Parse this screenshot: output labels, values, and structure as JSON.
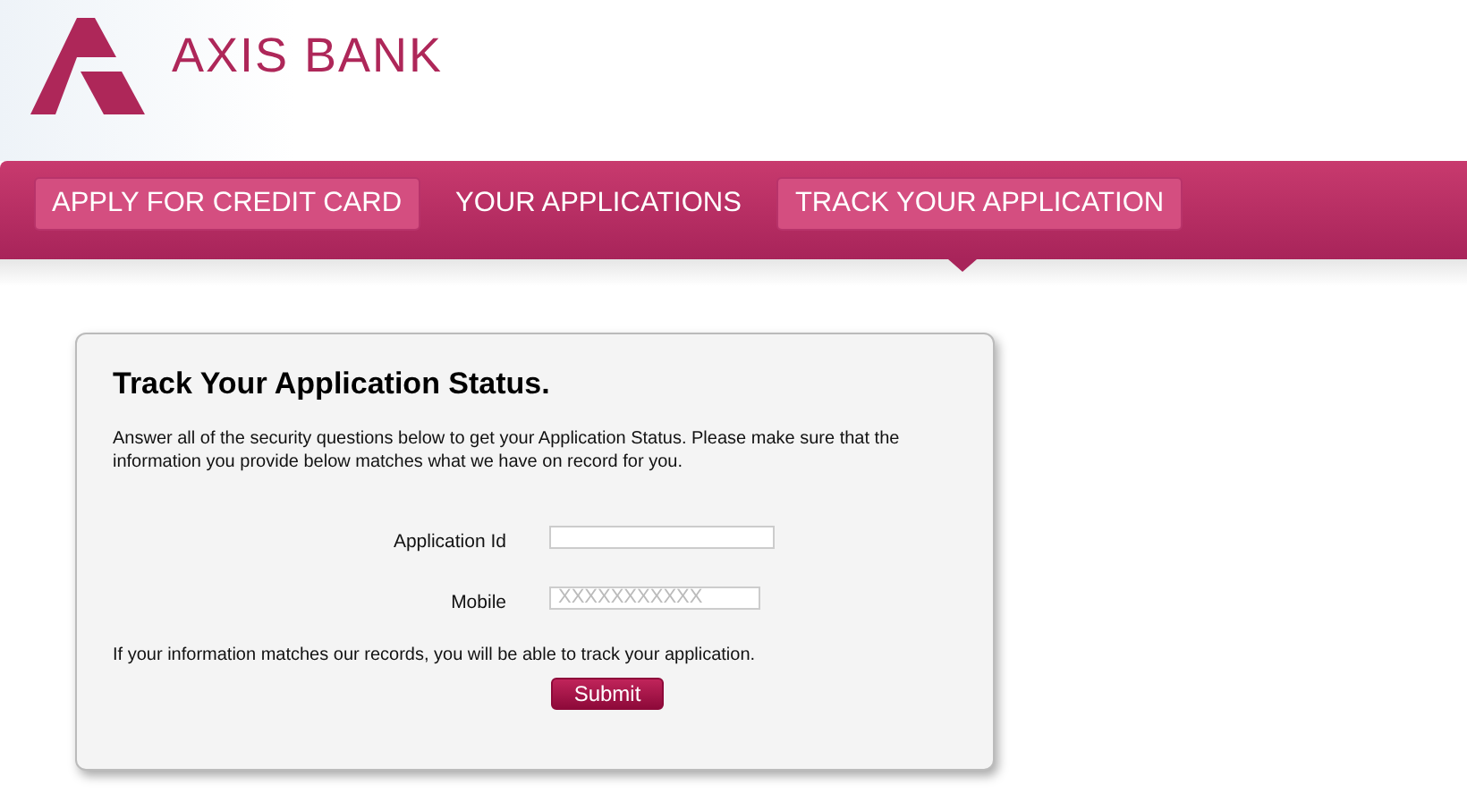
{
  "brand": {
    "name": "AXIS BANK"
  },
  "nav": [
    {
      "label": "APPLY FOR CREDIT CARD",
      "boxed": true,
      "selected": false
    },
    {
      "label": "YOUR APPLICATIONS",
      "boxed": false,
      "selected": false
    },
    {
      "label": "TRACK YOUR APPLICATION",
      "boxed": true,
      "selected": true
    }
  ],
  "form": {
    "title": "Track Your Application Status.",
    "intro": "Answer all of the security questions below to get your Application Status. Please make sure that the information you provide below matches what we have on record for you.",
    "fields": [
      {
        "label": "Application Id"
      },
      {
        "label": "Mobile",
        "placeholder": "XXXXXXXXXXX"
      }
    ],
    "note": "If your information matches our records, you will be able to track your application.",
    "submit": "Submit"
  }
}
